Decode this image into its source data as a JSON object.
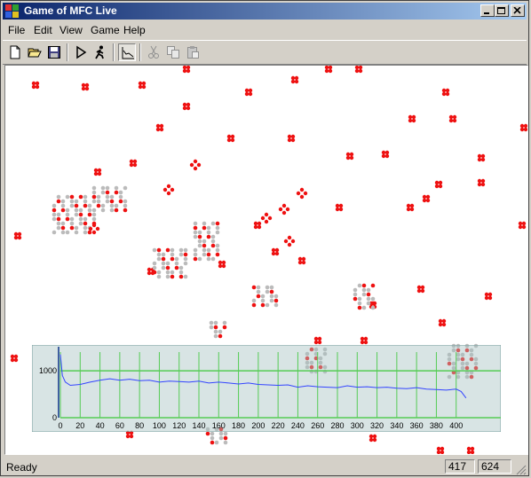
{
  "window": {
    "title": "Game of MFC Live"
  },
  "menu": {
    "items": [
      "File",
      "Edit",
      "View",
      "Game",
      "Help"
    ]
  },
  "toolbar": {
    "buttons": [
      "new-icon",
      "open-icon",
      "save-icon",
      "play-icon",
      "step-icon",
      "graph-icon",
      "cut-icon",
      "copy-icon",
      "paste-icon"
    ]
  },
  "status": {
    "text": "Ready",
    "pane1": "417",
    "pane2": "624"
  },
  "colors": {
    "live_cell": "#ee1111",
    "dead_cell": "#bbbbbb",
    "graph_line": "#3344ff",
    "graph_grid": "#55cc55"
  },
  "chart_data": {
    "type": "line",
    "x_ticks": [
      0,
      20,
      40,
      60,
      80,
      100,
      120,
      140,
      160,
      180,
      200,
      220,
      240,
      260,
      280,
      300,
      320,
      340,
      360,
      380,
      400
    ],
    "y_ticks": [
      0,
      1000
    ],
    "xlim": [
      0,
      420
    ],
    "ylim": [
      0,
      1400
    ],
    "series": [
      {
        "x": [
          0,
          2,
          5,
          10,
          20,
          30,
          40,
          50,
          60,
          70,
          80,
          90,
          100,
          110,
          120,
          130,
          140,
          150,
          160,
          170,
          180,
          190,
          200,
          210,
          220,
          230,
          240,
          250,
          260,
          270,
          280,
          290,
          300,
          310,
          320,
          330,
          340,
          350,
          360,
          370,
          380,
          390,
          400,
          405,
          410
        ],
        "values": [
          1350,
          900,
          760,
          690,
          710,
          760,
          800,
          830,
          800,
          820,
          790,
          800,
          760,
          780,
          770,
          760,
          780,
          740,
          760,
          740,
          720,
          740,
          710,
          700,
          690,
          700,
          650,
          680,
          660,
          650,
          640,
          680,
          650,
          660,
          640,
          650,
          630,
          620,
          640,
          610,
          600,
          590,
          610,
          560,
          420
        ]
      }
    ]
  }
}
